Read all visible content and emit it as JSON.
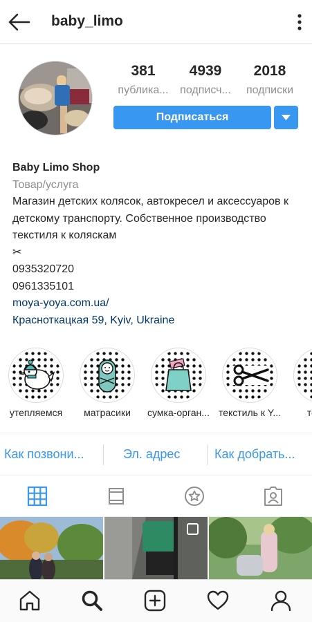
{
  "header": {
    "username": "baby_limo",
    "back_icon": "arrow-left-icon",
    "more_icon": "more-vertical-icon"
  },
  "profile": {
    "stats": [
      {
        "value": "381",
        "label": "публика..."
      },
      {
        "value": "4939",
        "label": "подписч..."
      },
      {
        "value": "2018",
        "label": "подписки"
      }
    ],
    "follow_label": "Подписаться",
    "accent": "#3897f0"
  },
  "bio": {
    "name": "Baby Limo Shop",
    "category": "Товар/услуга",
    "description": "Магазин детских колясок, автокресел и аксессуаров к детскому транспорту. Собственное производство текстиля к коляскам",
    "scissors": "✂",
    "phone1": "0935320720",
    "phone2": "0961335101",
    "website": "moya-yoya.com.ua/",
    "address": "Красноткацкая 59, Kyiv, Ukraine"
  },
  "highlights": [
    {
      "label": "утепляемся",
      "icon": "bird-hat-icon"
    },
    {
      "label": "матрасики",
      "icon": "swaddled-baby-icon"
    },
    {
      "label": "сумка-орган...",
      "icon": "shopping-bag-icon"
    },
    {
      "label": "текстиль к Y...",
      "icon": "scissors-icon"
    },
    {
      "label": "тест-д",
      "icon": "partial-highlight-icon"
    }
  ],
  "actions": {
    "call": "Как позвони...",
    "email": "Эл. адрес",
    "directions": "Как добрать..."
  },
  "tabs": [
    "grid-icon",
    "feed-icon",
    "star-icon",
    "tagged-icon"
  ],
  "bottom_nav": [
    "home-icon",
    "search-icon",
    "add-icon",
    "heart-icon",
    "profile-icon"
  ]
}
